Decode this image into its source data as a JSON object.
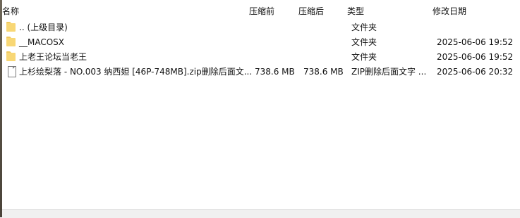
{
  "columns": {
    "name": "名称",
    "size": "压缩前",
    "packed": "压缩后",
    "type": "类型",
    "modified": "修改日期"
  },
  "files": [
    {
      "icon": "folder-icon",
      "name": ".. (上级目录)",
      "size": "",
      "packed": "",
      "type": "文件夹",
      "modified": ""
    },
    {
      "icon": "folder-icon",
      "name": "__MACOSX",
      "size": "",
      "packed": "",
      "type": "文件夹",
      "modified": "2025-06-06 19:52"
    },
    {
      "icon": "folder-icon",
      "name": "上老王论坛当老王",
      "size": "",
      "packed": "",
      "type": "文件夹",
      "modified": "2025-06-06 19:52"
    },
    {
      "icon": "file-icon",
      "name": "上杉绘梨落 - NO.003 纳西妲 [46P-748MB].zip删除后面文...",
      "size": "738.6 MB",
      "packed": "738.6 MB",
      "type": "ZIP删除后面文字 ...",
      "modified": "2025-06-06 20:32"
    }
  ]
}
